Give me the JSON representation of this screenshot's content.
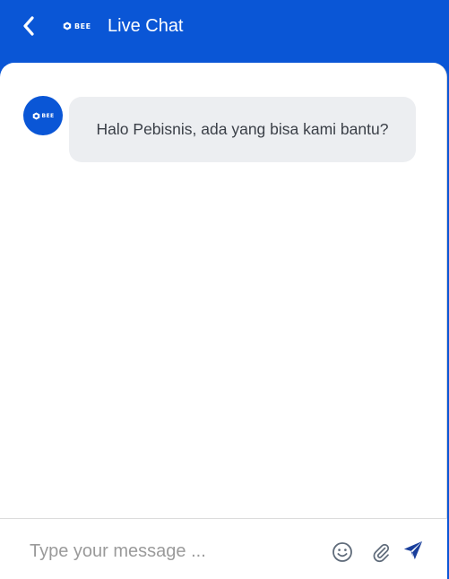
{
  "header": {
    "title": "Live Chat",
    "logo_text": "BEE",
    "back_icon": "chevron-left-icon",
    "background_color": "#0a56d6"
  },
  "messages": [
    {
      "sender": "bot",
      "avatar_text": "BEE",
      "text": "Halo Pebisnis, ada yang bisa kami bantu?"
    }
  ],
  "composer": {
    "placeholder": "Type your message ...",
    "value": "",
    "emoji_icon": "smiley-icon",
    "attach_icon": "paperclip-icon",
    "send_icon": "paper-plane-icon",
    "send_color": "#1a3f9c"
  }
}
